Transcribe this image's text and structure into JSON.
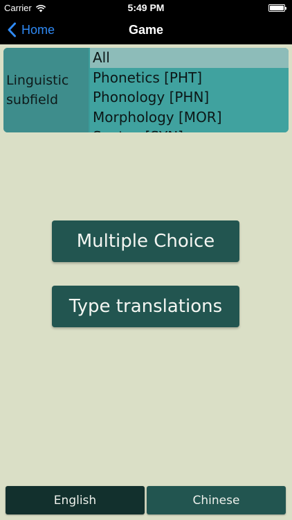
{
  "status_bar": {
    "carrier": "Carrier",
    "time": "5:49 PM",
    "battery_level": 1.0
  },
  "nav": {
    "back_label": "Home",
    "title": "Game"
  },
  "picker": {
    "label": "Linguistic subfield",
    "options": [
      "All",
      "Phonetics [PHT]",
      "Phonology [PHN]",
      "Morphology [MOR]",
      "Syntax [SYN]"
    ],
    "selected_index": 0
  },
  "buttons": {
    "multiple_choice": "Multiple Choice",
    "type_translations": "Type translations"
  },
  "language": {
    "english": "English",
    "chinese": "Chinese",
    "selected": "English"
  },
  "colors": {
    "background": "#dadfc6",
    "button": "#225550",
    "button_active": "#12302d",
    "picker": "#40a29f",
    "link": "#2f8af5"
  },
  "icons": {
    "wifi": "wifi-icon",
    "battery": "battery-icon",
    "back": "chevron-left-icon"
  }
}
